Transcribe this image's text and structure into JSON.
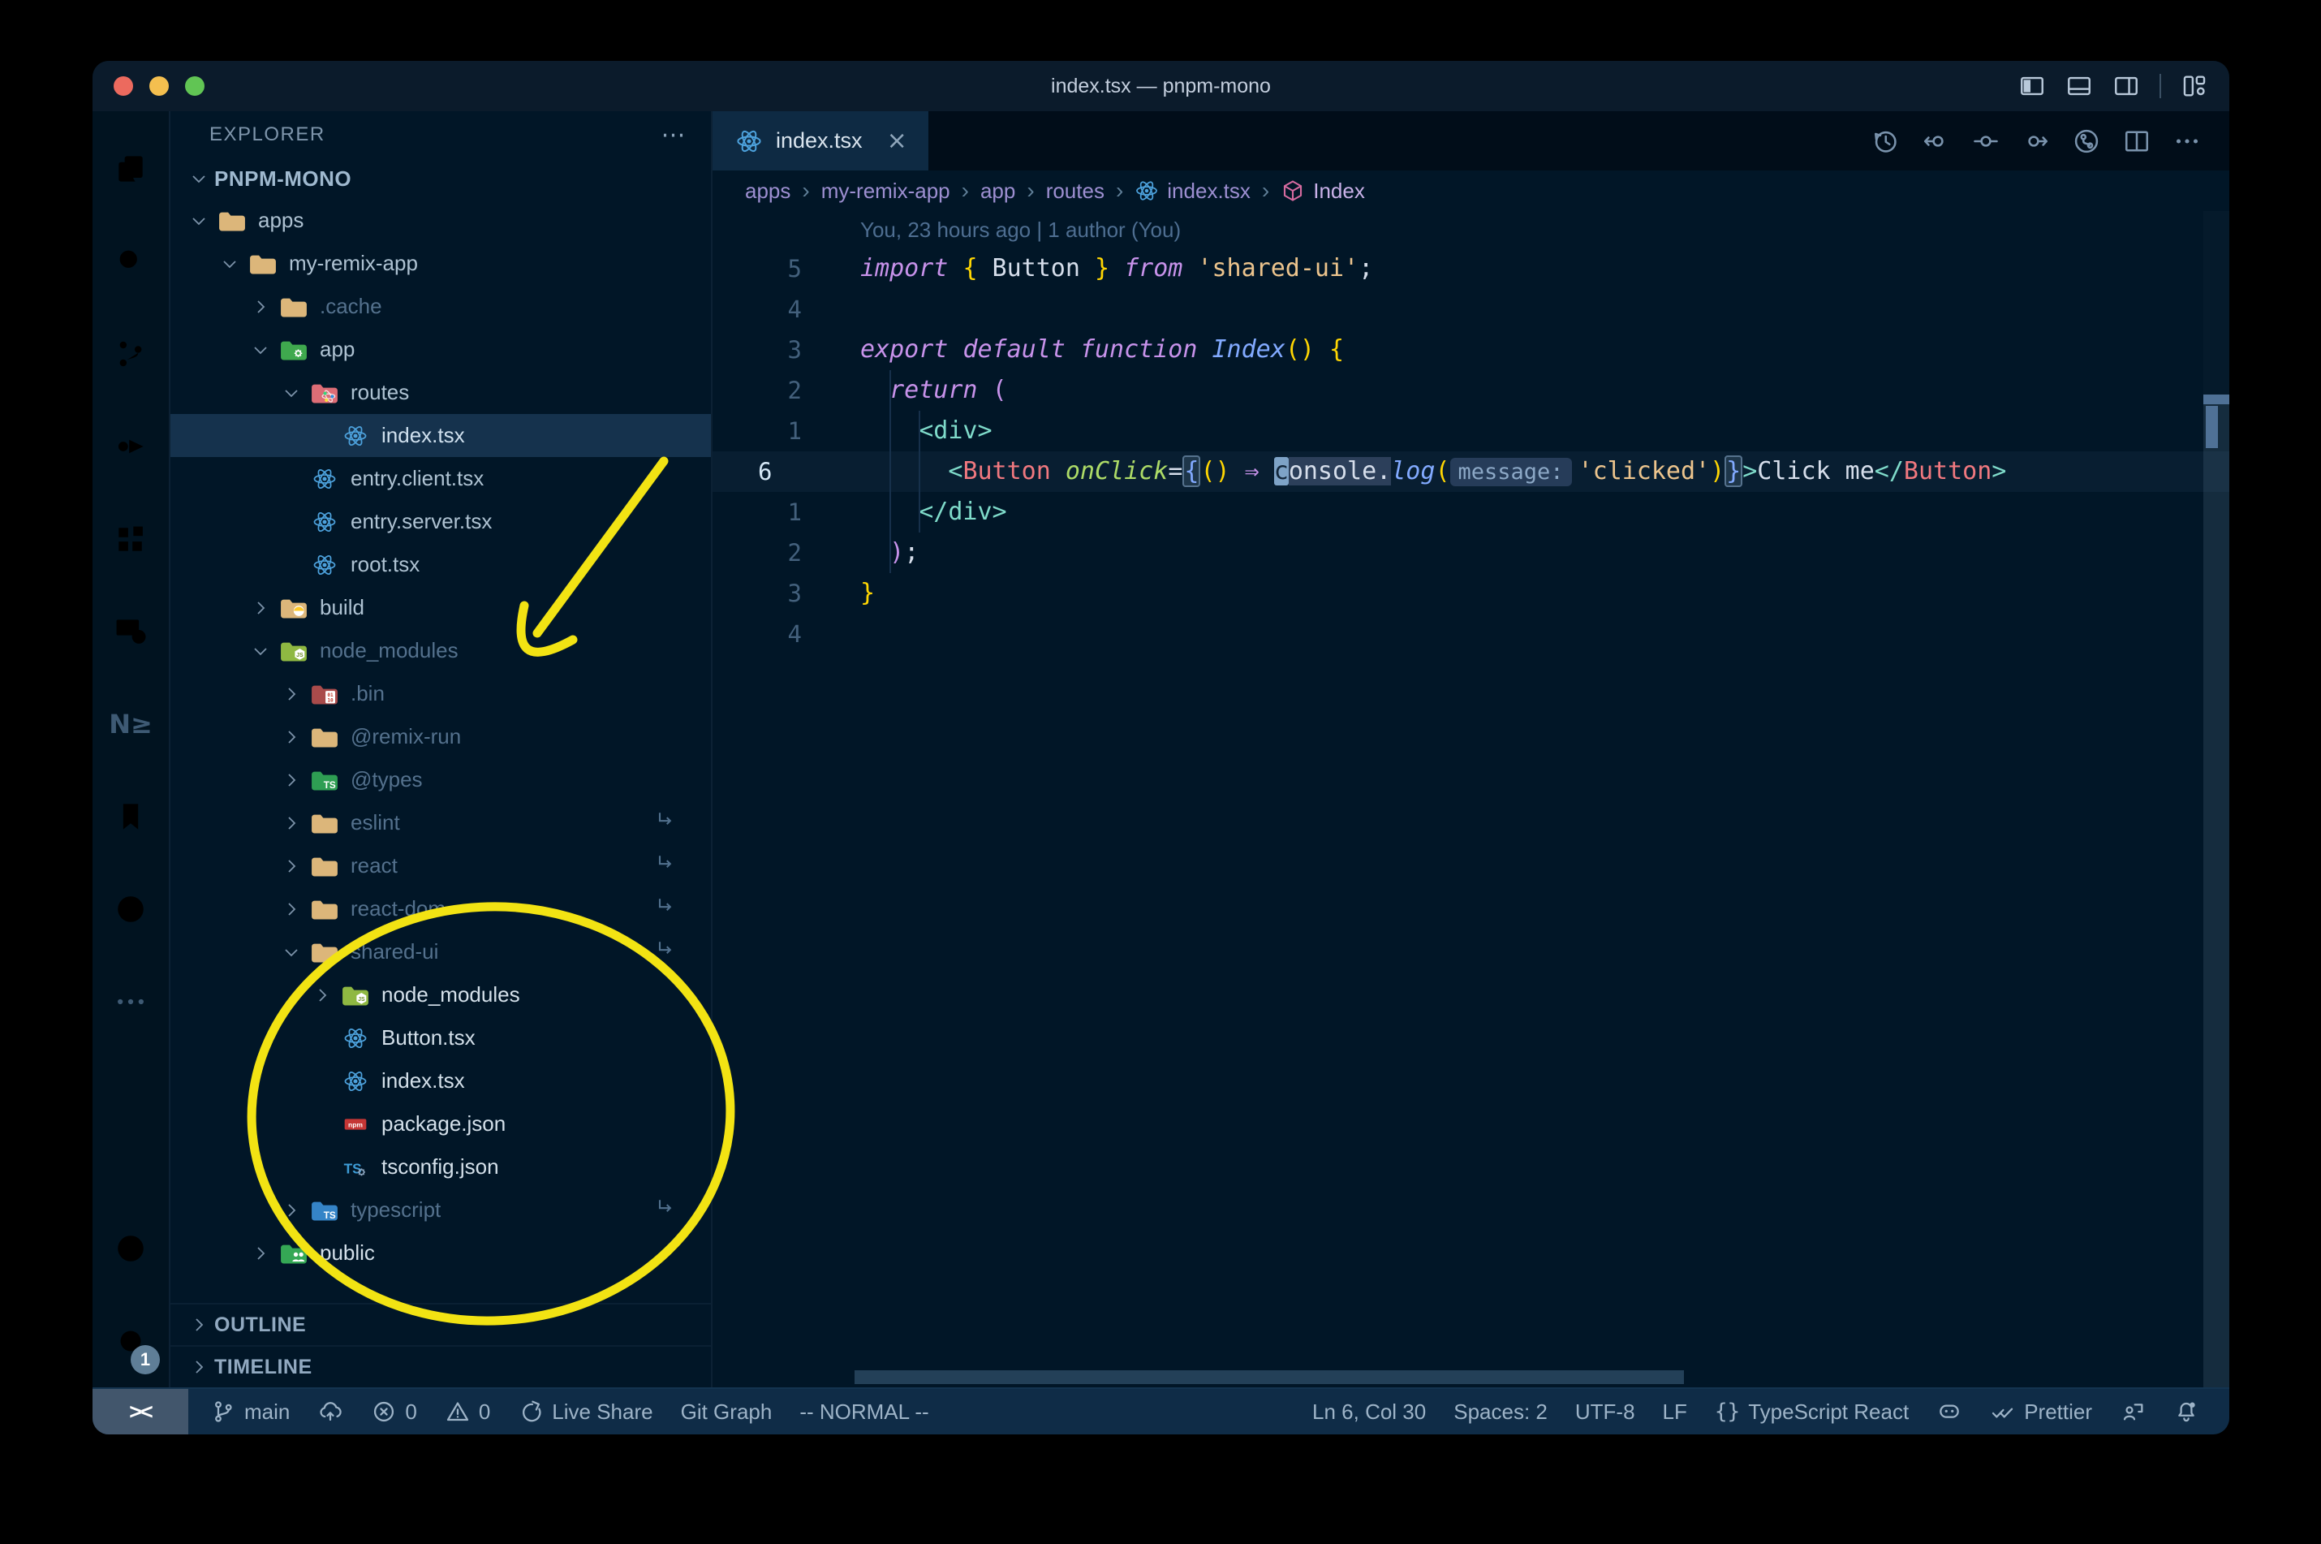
{
  "window": {
    "title": "index.tsx — pnpm-mono"
  },
  "colors": {
    "annotation": "#f2e313",
    "selection_row": "#15324d",
    "editor_bg": "#011627",
    "statusbar_bg": "#0f2c47",
    "accent_yellow_bracket": "#ffd602"
  },
  "activity_bar": {
    "top": [
      {
        "icon": "files-icon",
        "active": true
      },
      {
        "icon": "search-icon",
        "active": false
      },
      {
        "icon": "source-control-icon",
        "active": false
      },
      {
        "icon": "run-debug-icon",
        "active": false
      },
      {
        "icon": "extensions-icon",
        "active": false
      },
      {
        "icon": "remote-explorer-icon",
        "active": false
      },
      {
        "icon": "nx-console-icon",
        "active": false,
        "text": "N≥"
      },
      {
        "icon": "bookmarks-icon",
        "active": false
      },
      {
        "icon": "git-graph-icon",
        "active": false
      },
      {
        "icon": "more-icon",
        "active": false
      }
    ],
    "bottom": [
      {
        "icon": "account-icon"
      },
      {
        "icon": "settings-gear-icon",
        "badge": "1"
      }
    ]
  },
  "sidebar": {
    "header": "EXPLORER",
    "header_more": "⋯",
    "workspace": "PNPM-MONO",
    "outline": "OUTLINE",
    "timeline": "TIMELINE",
    "tree": [
      {
        "label": "apps",
        "level": 1,
        "kind": "folder",
        "icon": "folder-tan",
        "expanded": true
      },
      {
        "label": "my-remix-app",
        "level": 2,
        "kind": "folder",
        "icon": "folder-tan",
        "expanded": true
      },
      {
        "label": ".cache",
        "level": 3,
        "kind": "folder",
        "icon": "folder-tan",
        "expanded": false,
        "dim": true
      },
      {
        "label": "app",
        "level": 3,
        "kind": "folder",
        "icon": "folder-app",
        "expanded": true
      },
      {
        "label": "routes",
        "level": 4,
        "kind": "folder",
        "icon": "folder-routes",
        "expanded": true
      },
      {
        "label": "index.tsx",
        "level": 5,
        "kind": "file",
        "icon": "react",
        "selected": true
      },
      {
        "label": "entry.client.tsx",
        "level": 4,
        "kind": "file",
        "icon": "react"
      },
      {
        "label": "entry.server.tsx",
        "level": 4,
        "kind": "file",
        "icon": "react"
      },
      {
        "label": "root.tsx",
        "level": 4,
        "kind": "file",
        "icon": "react"
      },
      {
        "label": "build",
        "level": 3,
        "kind": "folder",
        "icon": "folder-build",
        "expanded": false
      },
      {
        "label": "node_modules",
        "level": 3,
        "kind": "folder",
        "icon": "folder-node",
        "expanded": true,
        "dim": true
      },
      {
        "label": ".bin",
        "level": 4,
        "kind": "folder",
        "icon": "folder-bin",
        "expanded": false,
        "dim": true
      },
      {
        "label": "@remix-run",
        "level": 4,
        "kind": "folder",
        "icon": "folder-tan",
        "expanded": false,
        "dim": true
      },
      {
        "label": "@types",
        "level": 4,
        "kind": "folder",
        "icon": "folder-types",
        "expanded": false,
        "dim": true
      },
      {
        "label": "eslint",
        "level": 4,
        "kind": "folder",
        "icon": "folder-tan",
        "expanded": false,
        "dim": true,
        "symlink": true
      },
      {
        "label": "react",
        "level": 4,
        "kind": "folder",
        "icon": "folder-tan",
        "expanded": false,
        "dim": true,
        "symlink": true
      },
      {
        "label": "react-dom",
        "level": 4,
        "kind": "folder",
        "icon": "folder-tan",
        "expanded": false,
        "dim": true,
        "symlink": true
      },
      {
        "label": "shared-ui",
        "level": 4,
        "kind": "folder",
        "icon": "folder-tan",
        "expanded": true,
        "dim": true,
        "symlink": true
      },
      {
        "label": "node_modules",
        "level": 5,
        "kind": "folder",
        "icon": "folder-node",
        "expanded": false,
        "bright": true
      },
      {
        "label": "Button.tsx",
        "level": 5,
        "kind": "file",
        "icon": "react",
        "bright": true
      },
      {
        "label": "index.tsx",
        "level": 5,
        "kind": "file",
        "icon": "react",
        "bright": true
      },
      {
        "label": "package.json",
        "level": 5,
        "kind": "file",
        "icon": "npm",
        "bright": true
      },
      {
        "label": "tsconfig.json",
        "level": 5,
        "kind": "file",
        "icon": "tsconfig",
        "bright": true
      },
      {
        "label": "typescript",
        "level": 4,
        "kind": "folder",
        "icon": "folder-ts-blue",
        "expanded": false,
        "dim": true,
        "symlink": true
      },
      {
        "label": "public",
        "level": 3,
        "kind": "folder",
        "icon": "folder-public",
        "expanded": false,
        "bright": true
      }
    ]
  },
  "tabs": [
    {
      "label": "index.tsx",
      "icon": "react-icon",
      "close": "×",
      "active": true
    }
  ],
  "editor_actions": [
    {
      "icon": "history-icon"
    },
    {
      "icon": "previous-change-icon"
    },
    {
      "icon": "open-change-icon"
    },
    {
      "icon": "next-change-icon"
    },
    {
      "icon": "gitlens-graph-icon"
    },
    {
      "icon": "split-editor-icon"
    },
    {
      "icon": "more-actions-icon"
    }
  ],
  "breadcrumbs": [
    {
      "label": "apps"
    },
    {
      "label": "my-remix-app"
    },
    {
      "label": "app"
    },
    {
      "label": "routes"
    },
    {
      "label": "index.tsx",
      "icon": "react-icon"
    },
    {
      "label": "Index",
      "icon": "symbol-module-icon"
    }
  ],
  "editor": {
    "blame": "You, 23 hours ago | 1 author (You)",
    "lines": [
      {
        "num": "5",
        "tokens": [
          [
            "kw",
            "import"
          ],
          [
            "pl",
            " "
          ],
          [
            "g",
            "{"
          ],
          [
            "pl",
            " Button "
          ],
          [
            "g",
            "}"
          ],
          [
            "pl",
            " "
          ],
          [
            "kw",
            "from"
          ],
          [
            "pl",
            " "
          ],
          [
            "str",
            "'shared-ui'"
          ],
          [
            "pl",
            ";"
          ]
        ]
      },
      {
        "num": "4",
        "tokens": []
      },
      {
        "num": "3",
        "tokens": [
          [
            "kw",
            "export"
          ],
          [
            "pl",
            " "
          ],
          [
            "kw",
            "default"
          ],
          [
            "pl",
            " "
          ],
          [
            "kw",
            "function"
          ],
          [
            "pl",
            " "
          ],
          [
            "fn",
            "Index"
          ],
          [
            "g",
            "()"
          ],
          [
            "pl",
            " "
          ],
          [
            "g",
            "{"
          ]
        ]
      },
      {
        "num": "2",
        "tokens": [
          [
            "pl",
            "  "
          ],
          [
            "kw",
            "return"
          ],
          [
            "pl",
            " "
          ],
          [
            "p",
            "("
          ]
        ]
      },
      {
        "num": "1",
        "tokens": [
          [
            "pl",
            "    "
          ],
          [
            "tag",
            "<div>"
          ]
        ]
      },
      {
        "num": "6",
        "current": true,
        "tokens": [
          [
            "pl",
            "      "
          ],
          [
            "tag",
            "<"
          ],
          [
            "comp",
            "Button"
          ],
          [
            "pl",
            " "
          ],
          [
            "attr",
            "onClick"
          ],
          [
            "pl",
            "="
          ],
          [
            "bm",
            "{"
          ],
          [
            "g",
            "()"
          ],
          [
            "pl",
            " "
          ],
          [
            "p",
            "⇒"
          ],
          [
            "pl",
            " "
          ],
          [
            "cur",
            "c"
          ],
          [
            "hl",
            "onsole."
          ],
          [
            "fn",
            "log"
          ],
          [
            "g",
            "("
          ],
          [
            "inlay",
            "message:"
          ],
          [
            "str",
            "'clicked'"
          ],
          [
            "g",
            ")"
          ],
          [
            "bm",
            "}"
          ],
          [
            "tag",
            ">"
          ],
          [
            "pl",
            "Click me"
          ],
          [
            "tag",
            "</"
          ],
          [
            "comp",
            "Button"
          ],
          [
            "tag",
            ">"
          ]
        ]
      },
      {
        "num": "1",
        "tokens": [
          [
            "pl",
            "    "
          ],
          [
            "tag",
            "</div>"
          ]
        ]
      },
      {
        "num": "2",
        "tokens": [
          [
            "pl",
            "  "
          ],
          [
            "p",
            ")"
          ],
          [
            "pl",
            ";"
          ]
        ]
      },
      {
        "num": "3",
        "tokens": [
          [
            "g",
            "}"
          ]
        ]
      },
      {
        "num": "4",
        "tokens": []
      }
    ]
  },
  "status_bar": {
    "remote": "><",
    "left": [
      {
        "icon": "git-branch-icon",
        "label": "main"
      },
      {
        "icon": "cloud-upload-icon",
        "label": ""
      },
      {
        "icon": "errors-icon",
        "label": "0"
      },
      {
        "icon": "warnings-icon",
        "label": "0"
      },
      {
        "icon": "live-share-icon",
        "label": "Live Share"
      },
      {
        "icon": "",
        "label": "Git Graph"
      },
      {
        "icon": "",
        "label": "-- NORMAL --"
      }
    ],
    "right": [
      {
        "icon": "",
        "label": "Ln 6, Col 30"
      },
      {
        "icon": "",
        "label": "Spaces: 2"
      },
      {
        "icon": "",
        "label": "UTF-8"
      },
      {
        "icon": "",
        "label": "LF"
      },
      {
        "icon": "braces-icon",
        "label": "TypeScript React"
      },
      {
        "icon": "copilot-icon",
        "label": ""
      },
      {
        "icon": "prettier-check-icon",
        "label": "Prettier"
      },
      {
        "icon": "feedback-icon",
        "label": ""
      },
      {
        "icon": "bell-dot-icon",
        "label": ""
      }
    ]
  }
}
